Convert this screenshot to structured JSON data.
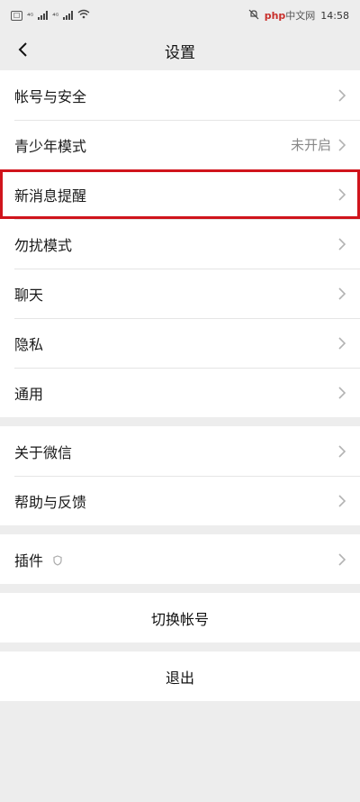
{
  "status": {
    "time": "14:58",
    "watermark_a": "php",
    "watermark_b": "中文网"
  },
  "header": {
    "title": "设置"
  },
  "groups": [
    {
      "items": [
        {
          "label": "帐号与安全",
          "value": ""
        },
        {
          "label": "青少年模式",
          "value": "未开启"
        },
        {
          "label": "新消息提醒",
          "value": "",
          "highlighted": true
        },
        {
          "label": "勿扰模式",
          "value": ""
        },
        {
          "label": "聊天",
          "value": ""
        },
        {
          "label": "隐私",
          "value": ""
        },
        {
          "label": "通用",
          "value": ""
        }
      ]
    },
    {
      "items": [
        {
          "label": "关于微信",
          "value": ""
        },
        {
          "label": "帮助与反馈",
          "value": ""
        }
      ]
    },
    {
      "items": [
        {
          "label": "插件",
          "value": ""
        }
      ]
    }
  ],
  "actions": {
    "switch_account": "切换帐号",
    "logout": "退出"
  },
  "colors": {
    "highlight": "#d0141c",
    "background": "#ededed"
  }
}
